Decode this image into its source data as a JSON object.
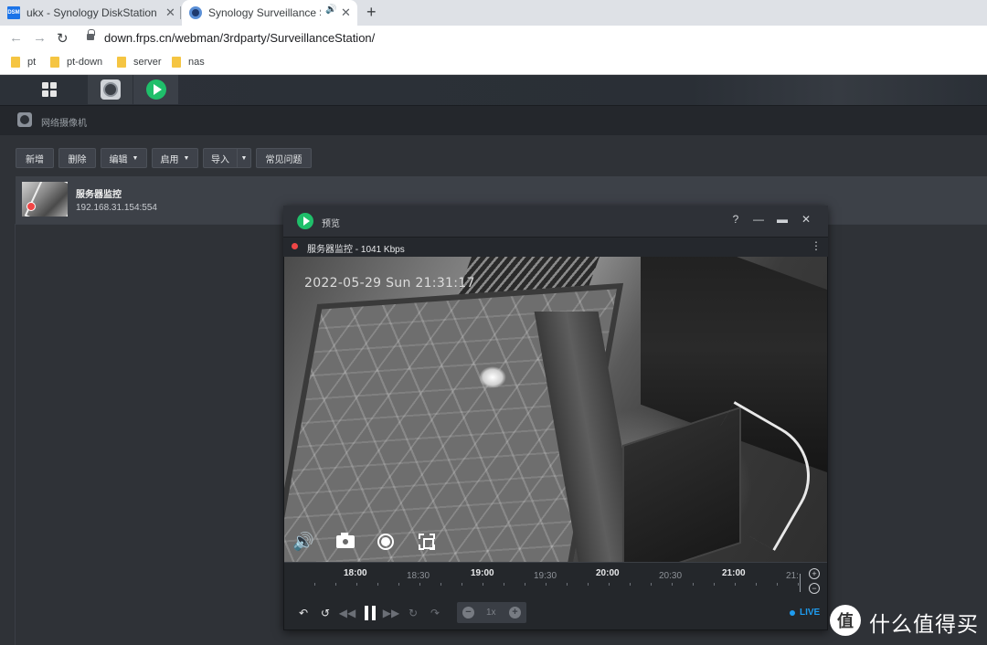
{
  "browser": {
    "tabs": [
      {
        "title": "ukx - Synology DiskStation",
        "favicon": "DSM"
      },
      {
        "title": "Synology Surveillance Station",
        "audio": "speaker-icon"
      }
    ],
    "url": "down.frps.cn/webman/3rdparty/SurveillanceStation/",
    "bookmarks": [
      "pt",
      "pt-down",
      "server",
      "nas"
    ]
  },
  "app": {
    "section_title": "网络摄像机",
    "toolbar": {
      "add": "新增",
      "delete": "删除",
      "edit": "编辑",
      "enable": "启用",
      "import": "导入",
      "faq": "常见问题"
    },
    "camera": {
      "name": "服务器监控",
      "address": "192.168.31.154:554"
    }
  },
  "preview": {
    "title": "预览",
    "help": "?",
    "stream_label": "服务器监控 - 1041 Kbps",
    "osd_timestamp": "2022-05-29 Sun 21:31:17",
    "timeline": {
      "major": [
        "18:00",
        "19:00",
        "20:00",
        "21:00"
      ],
      "minor": [
        "18:30",
        "19:30",
        "20:30",
        "21:"
      ]
    },
    "speed": "1x",
    "live": "LIVE",
    "colors": {
      "accent": "#1fbf6a",
      "live": "#1e9cf0",
      "record": "#f04646"
    }
  },
  "watermark": {
    "logo": "值",
    "text": "什么值得买"
  }
}
